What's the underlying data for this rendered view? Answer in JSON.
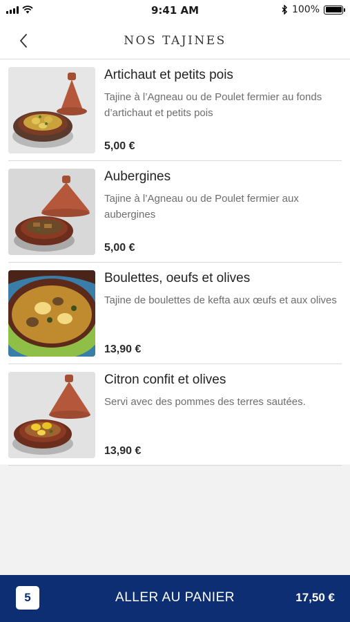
{
  "status_bar": {
    "time": "9:41 AM",
    "battery": "100%",
    "icons": [
      "signal-icon",
      "wifi-icon",
      "bluetooth-icon",
      "battery-icon"
    ]
  },
  "header": {
    "title": "NOS TAJINES",
    "back_icon": "chevron-left-icon"
  },
  "items": [
    {
      "name": "Artichaut et petits pois",
      "description": "Tajine à l’Agneau ou de Poulet fermier au fonds d’artichaut et petits pois",
      "price": "5,00 €",
      "image": "tajine-artichoke-photo"
    },
    {
      "name": "Aubergines",
      "description": "Tajine à l’Agneau ou de Poulet fermier aux aubergines",
      "price": "5,00 €",
      "image": "tajine-eggplant-photo"
    },
    {
      "name": "Boulettes, oeufs et olives",
      "description": "Tajine de boulettes de kefta aux œufs et aux olives",
      "price": "13,90 €",
      "image": "tajine-meatballs-photo"
    },
    {
      "name": "Citron confit et olives",
      "description": "Servi avec des pommes des terres sautées.",
      "price": "13,90 €",
      "image": "tajine-lemon-photo"
    }
  ],
  "cart": {
    "count": "5",
    "label": "ALLER AU PANIER",
    "total": "17,50 €"
  },
  "colors": {
    "accent": "#0d2e73",
    "background": "#f2f2f2",
    "clay": "#b5573b"
  }
}
